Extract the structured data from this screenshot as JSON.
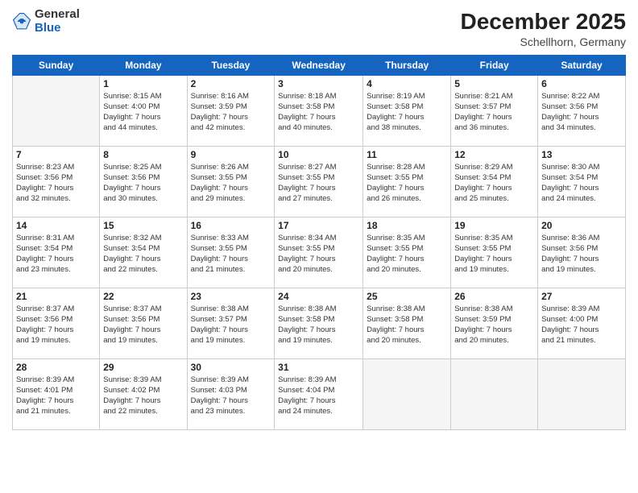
{
  "logo": {
    "general": "General",
    "blue": "Blue"
  },
  "header": {
    "title": "December 2025",
    "subtitle": "Schellhorn, Germany"
  },
  "days_of_week": [
    "Sunday",
    "Monday",
    "Tuesday",
    "Wednesday",
    "Thursday",
    "Friday",
    "Saturday"
  ],
  "weeks": [
    [
      {
        "day": "",
        "info": ""
      },
      {
        "day": "1",
        "info": "Sunrise: 8:15 AM\nSunset: 4:00 PM\nDaylight: 7 hours\nand 44 minutes."
      },
      {
        "day": "2",
        "info": "Sunrise: 8:16 AM\nSunset: 3:59 PM\nDaylight: 7 hours\nand 42 minutes."
      },
      {
        "day": "3",
        "info": "Sunrise: 8:18 AM\nSunset: 3:58 PM\nDaylight: 7 hours\nand 40 minutes."
      },
      {
        "day": "4",
        "info": "Sunrise: 8:19 AM\nSunset: 3:58 PM\nDaylight: 7 hours\nand 38 minutes."
      },
      {
        "day": "5",
        "info": "Sunrise: 8:21 AM\nSunset: 3:57 PM\nDaylight: 7 hours\nand 36 minutes."
      },
      {
        "day": "6",
        "info": "Sunrise: 8:22 AM\nSunset: 3:56 PM\nDaylight: 7 hours\nand 34 minutes."
      }
    ],
    [
      {
        "day": "7",
        "info": "Sunrise: 8:23 AM\nSunset: 3:56 PM\nDaylight: 7 hours\nand 32 minutes."
      },
      {
        "day": "8",
        "info": "Sunrise: 8:25 AM\nSunset: 3:56 PM\nDaylight: 7 hours\nand 30 minutes."
      },
      {
        "day": "9",
        "info": "Sunrise: 8:26 AM\nSunset: 3:55 PM\nDaylight: 7 hours\nand 29 minutes."
      },
      {
        "day": "10",
        "info": "Sunrise: 8:27 AM\nSunset: 3:55 PM\nDaylight: 7 hours\nand 27 minutes."
      },
      {
        "day": "11",
        "info": "Sunrise: 8:28 AM\nSunset: 3:55 PM\nDaylight: 7 hours\nand 26 minutes."
      },
      {
        "day": "12",
        "info": "Sunrise: 8:29 AM\nSunset: 3:54 PM\nDaylight: 7 hours\nand 25 minutes."
      },
      {
        "day": "13",
        "info": "Sunrise: 8:30 AM\nSunset: 3:54 PM\nDaylight: 7 hours\nand 24 minutes."
      }
    ],
    [
      {
        "day": "14",
        "info": "Sunrise: 8:31 AM\nSunset: 3:54 PM\nDaylight: 7 hours\nand 23 minutes."
      },
      {
        "day": "15",
        "info": "Sunrise: 8:32 AM\nSunset: 3:54 PM\nDaylight: 7 hours\nand 22 minutes."
      },
      {
        "day": "16",
        "info": "Sunrise: 8:33 AM\nSunset: 3:55 PM\nDaylight: 7 hours\nand 21 minutes."
      },
      {
        "day": "17",
        "info": "Sunrise: 8:34 AM\nSunset: 3:55 PM\nDaylight: 7 hours\nand 20 minutes."
      },
      {
        "day": "18",
        "info": "Sunrise: 8:35 AM\nSunset: 3:55 PM\nDaylight: 7 hours\nand 20 minutes."
      },
      {
        "day": "19",
        "info": "Sunrise: 8:35 AM\nSunset: 3:55 PM\nDaylight: 7 hours\nand 19 minutes."
      },
      {
        "day": "20",
        "info": "Sunrise: 8:36 AM\nSunset: 3:56 PM\nDaylight: 7 hours\nand 19 minutes."
      }
    ],
    [
      {
        "day": "21",
        "info": "Sunrise: 8:37 AM\nSunset: 3:56 PM\nDaylight: 7 hours\nand 19 minutes."
      },
      {
        "day": "22",
        "info": "Sunrise: 8:37 AM\nSunset: 3:56 PM\nDaylight: 7 hours\nand 19 minutes."
      },
      {
        "day": "23",
        "info": "Sunrise: 8:38 AM\nSunset: 3:57 PM\nDaylight: 7 hours\nand 19 minutes."
      },
      {
        "day": "24",
        "info": "Sunrise: 8:38 AM\nSunset: 3:58 PM\nDaylight: 7 hours\nand 19 minutes."
      },
      {
        "day": "25",
        "info": "Sunrise: 8:38 AM\nSunset: 3:58 PM\nDaylight: 7 hours\nand 20 minutes."
      },
      {
        "day": "26",
        "info": "Sunrise: 8:38 AM\nSunset: 3:59 PM\nDaylight: 7 hours\nand 20 minutes."
      },
      {
        "day": "27",
        "info": "Sunrise: 8:39 AM\nSunset: 4:00 PM\nDaylight: 7 hours\nand 21 minutes."
      }
    ],
    [
      {
        "day": "28",
        "info": "Sunrise: 8:39 AM\nSunset: 4:01 PM\nDaylight: 7 hours\nand 21 minutes."
      },
      {
        "day": "29",
        "info": "Sunrise: 8:39 AM\nSunset: 4:02 PM\nDaylight: 7 hours\nand 22 minutes."
      },
      {
        "day": "30",
        "info": "Sunrise: 8:39 AM\nSunset: 4:03 PM\nDaylight: 7 hours\nand 23 minutes."
      },
      {
        "day": "31",
        "info": "Sunrise: 8:39 AM\nSunset: 4:04 PM\nDaylight: 7 hours\nand 24 minutes."
      },
      {
        "day": "",
        "info": ""
      },
      {
        "day": "",
        "info": ""
      },
      {
        "day": "",
        "info": ""
      }
    ]
  ]
}
